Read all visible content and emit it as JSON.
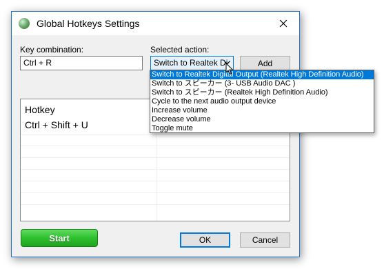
{
  "window": {
    "title": "Global Hotkeys Settings"
  },
  "form": {
    "key_label": "Key combination:",
    "key_value": "Ctrl + R",
    "action_label": "Selected action:",
    "action_value": "Switch to Realtek Di",
    "add_label": "Add"
  },
  "list": {
    "header": "Hotkey",
    "rows": [
      "Ctrl + Shift + U"
    ]
  },
  "dropdown": {
    "options": [
      "Switch to Realtek Digital Output (Realtek High Definition Audio)",
      "Switch to スピーカー (3- USB Audio DAC   )",
      "Switch to スピーカー (Realtek High Definition Audio)",
      "Cycle to the next audio output device",
      "Increase volume",
      "Decrease volume",
      "Toggle mute"
    ],
    "selected_index": 0
  },
  "buttons": {
    "start": "Start",
    "ok": "OK",
    "cancel": "Cancel"
  },
  "colors": {
    "accent": "#0078d7",
    "start_green": "#2fbf2f"
  }
}
